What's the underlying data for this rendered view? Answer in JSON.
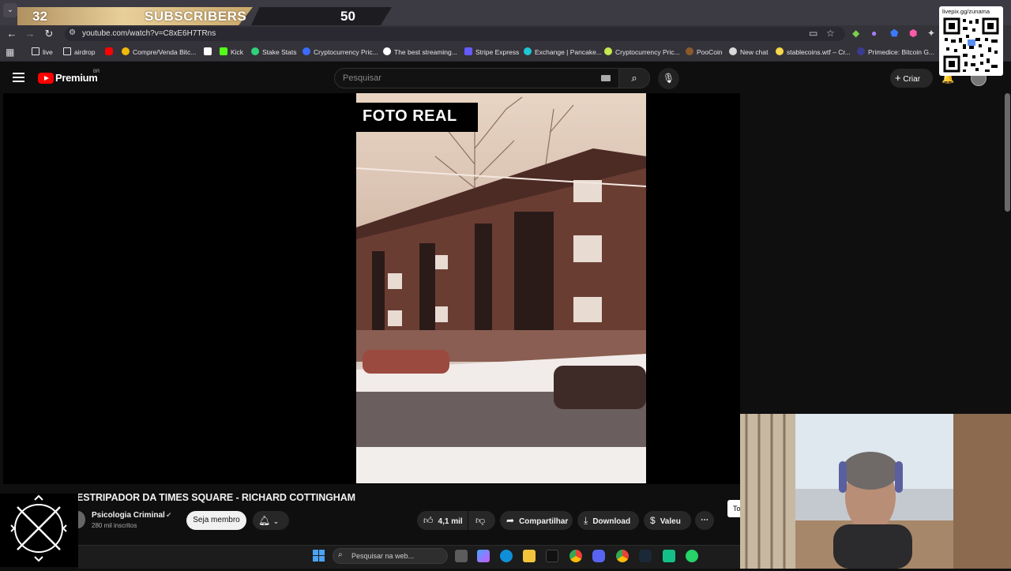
{
  "stream_overlay": {
    "subscriber_count": "32",
    "subscribers_label": "SUBSCRIBERS",
    "goal": "50",
    "qr_caption": "livepix.gg/zunama"
  },
  "browser": {
    "url": "youtube.com/watch?v=C8xE6H7TRns",
    "bookmarks": [
      {
        "label": "live",
        "color": "#e6e6e6"
      },
      {
        "label": "airdrop",
        "color": "#e6e6e6"
      },
      {
        "label": "",
        "color": "#ff0000"
      },
      {
        "label": "Compre/Venda Bitc...",
        "color": "#f0b90b"
      },
      {
        "label": "",
        "color": "#ffffff"
      },
      {
        "label": "Kick",
        "color": "#53fc18"
      },
      {
        "label": "Stake Stats",
        "color": "#2fd27a"
      },
      {
        "label": "Cryptocurrency Pric...",
        "color": "#3c6bff"
      },
      {
        "label": "The best streaming...",
        "color": "#ffffff"
      },
      {
        "label": "Stripe Express",
        "color": "#635bff"
      },
      {
        "label": "Exchange | Pancake...",
        "color": "#1fc7d4"
      },
      {
        "label": "Cryptocurrency Pric...",
        "color": "#c6e94f"
      },
      {
        "label": "PooCoin",
        "color": "#8a5a2b"
      },
      {
        "label": "New chat",
        "color": "#d9d9d9"
      },
      {
        "label": "stablecoins.wtf – Cr...",
        "color": "#f7d84a"
      },
      {
        "label": "Primedice: Bitcoin G...",
        "color": "#3b3b8f"
      }
    ]
  },
  "youtube": {
    "logo_text": "Premium",
    "country": "BR",
    "search_placeholder": "Pesquisar",
    "create_label": "Criar",
    "video_overlay_label": "FOTO REAL",
    "title": "ESTRIPADOR DA TIMES SQUARE - RICHARD COTTINGHAM",
    "channel_name": "Psicologia Criminal",
    "channel_subs": "280 mil inscritos",
    "member_label": "Seja membro",
    "likes": "4,1 mil",
    "share_label": "Compartilhar",
    "download_label": "Download",
    "thanks_label": "Valeu",
    "tooltip_fragment": "To"
  },
  "taskbar": {
    "search_placeholder": "Pesquisar na web..."
  },
  "colors": {
    "yt_red": "#ff0000",
    "banner_gold": "#d9bc85",
    "windows_blue": "#4ba3f5"
  }
}
